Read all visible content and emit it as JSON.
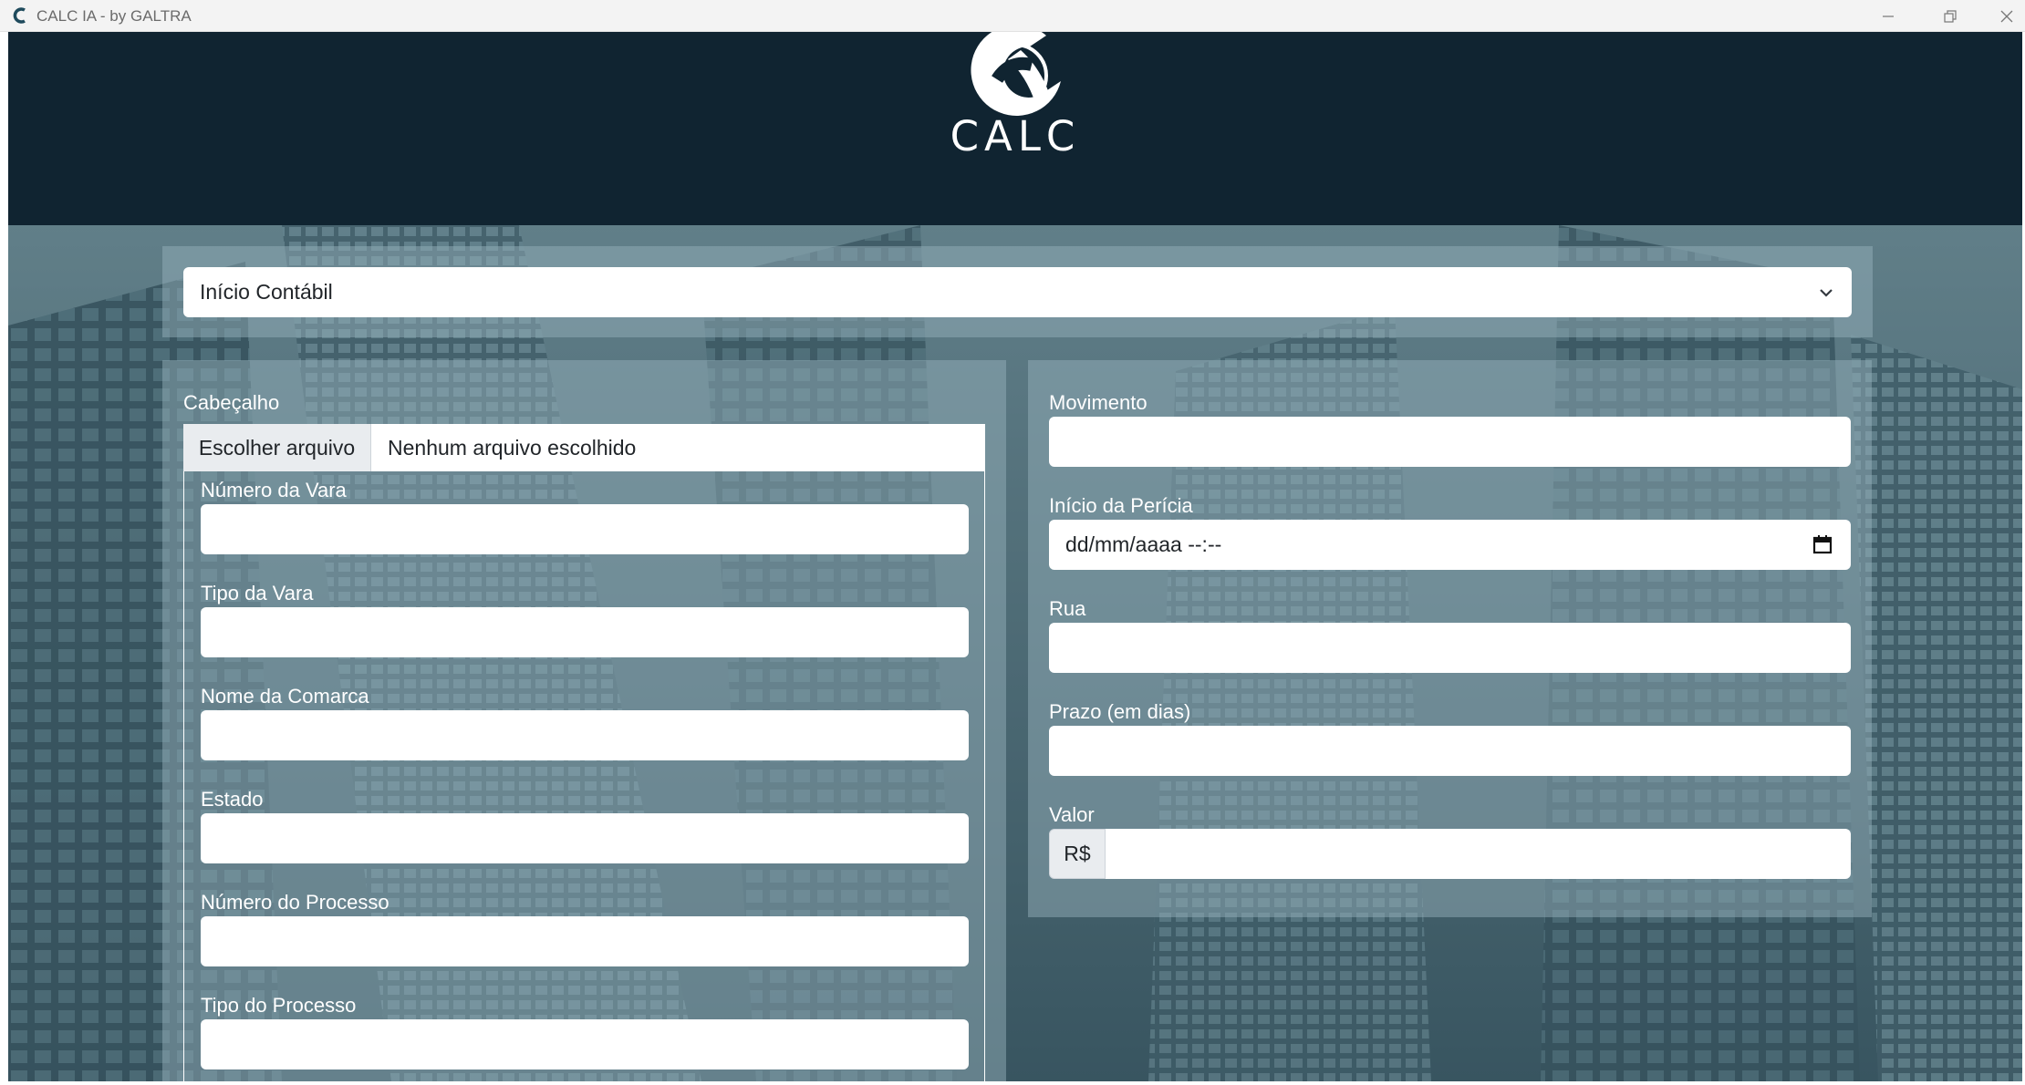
{
  "window": {
    "title": "CALC IA - by GALTRA",
    "icons": [
      "app-logo-icon",
      "minimize-icon",
      "restore-icon",
      "close-icon"
    ]
  },
  "brand": {
    "logo_text": "CALC",
    "header_color": "#102431"
  },
  "top_select": {
    "value": "Início Contábil"
  },
  "cabecalho": {
    "legend": "Cabeçalho",
    "file_button": "Escolher arquivo",
    "file_status": "Nenhum arquivo escolhido",
    "fields": [
      {
        "label": "Número da Vara",
        "value": ""
      },
      {
        "label": "Tipo da Vara",
        "value": ""
      },
      {
        "label": "Nome da Comarca",
        "value": ""
      },
      {
        "label": "Estado",
        "value": ""
      },
      {
        "label": "Número do Processo",
        "value": ""
      },
      {
        "label": "Tipo do Processo",
        "value": ""
      }
    ]
  },
  "right_form": {
    "movimento_label": "Movimento",
    "inicio_pericia_label": "Início da Perícia",
    "inicio_pericia_value": "dd/mm/aaaa --:--",
    "rua_label": "Rua",
    "prazo_label": "Prazo (em dias)",
    "valor_label": "Valor",
    "valor_prefix": "R$"
  }
}
